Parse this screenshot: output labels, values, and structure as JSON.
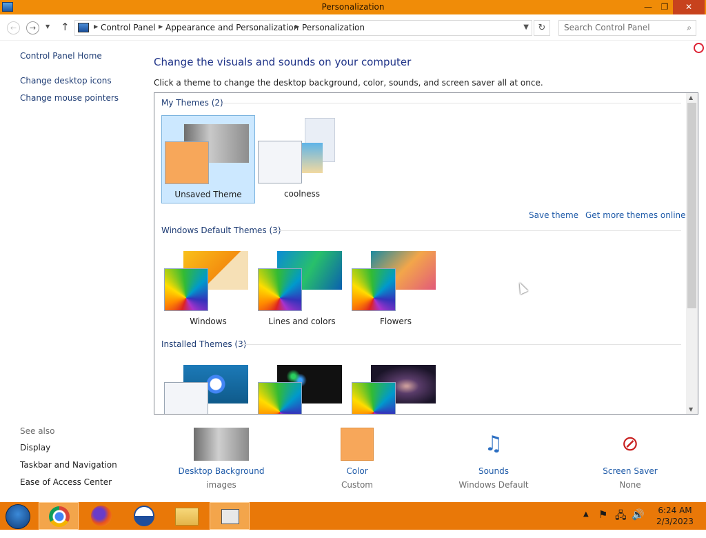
{
  "window": {
    "title": "Personalization",
    "close_glyph": "✕",
    "min_glyph": "—",
    "max_glyph": "❐"
  },
  "navbar": {
    "back_glyph": "←",
    "forward_glyph": "→",
    "up_glyph": "↑",
    "refresh_glyph": "↻",
    "breadcrumbs": [
      "Control Panel",
      "Appearance and Personalization",
      "Personalization"
    ],
    "search_placeholder": "Search Control Panel"
  },
  "left_pane": {
    "home": "Control Panel Home",
    "links": [
      "Change desktop icons",
      "Change mouse pointers"
    ],
    "see_also_label": "See also",
    "see_also": [
      "Display",
      "Taskbar and Navigation",
      "Ease of Access Center"
    ]
  },
  "main": {
    "heading": "Change the visuals and sounds on your computer",
    "subheading": "Click a theme to change the desktop background, color, sounds, and screen saver all at once.",
    "groups": [
      {
        "title": "My Themes (2)",
        "themes": [
          {
            "name": "Unsaved Theme",
            "selected": true
          },
          {
            "name": "coolness",
            "selected": false
          }
        ]
      },
      {
        "title": "Windows Default Themes (3)",
        "themes": [
          {
            "name": "Windows"
          },
          {
            "name": "Lines and colors"
          },
          {
            "name": "Flowers"
          }
        ]
      },
      {
        "title": "Installed Themes (3)",
        "themes": [
          {
            "name": ""
          },
          {
            "name": ""
          },
          {
            "name": ""
          }
        ]
      }
    ],
    "save_theme": "Save theme",
    "get_more": "Get more themes online"
  },
  "bottom": [
    {
      "label": "Desktop Background",
      "value": "images",
      "icon": "desktop-background-icon"
    },
    {
      "label": "Color",
      "value": "Custom",
      "icon": "color-swatch-icon",
      "swatch": "#f7a75a"
    },
    {
      "label": "Sounds",
      "value": "Windows Default",
      "icon": "sounds-icon"
    },
    {
      "label": "Screen Saver",
      "value": "None",
      "icon": "screen-saver-icon"
    }
  ],
  "taskbar": {
    "time": "6:24 AM",
    "date": "2/3/2023",
    "apps": [
      "chrome-icon",
      "firefox-icon",
      "obama-logo-icon",
      "file-explorer-icon",
      "control-panel-icon"
    ]
  },
  "colors": {
    "accent": "#f08c08",
    "taskbar": "#e97808",
    "link": "#1e3c74",
    "heading": "#1e3287"
  }
}
